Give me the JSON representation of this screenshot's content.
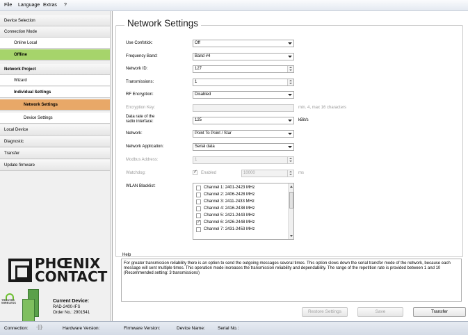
{
  "menu": [
    "File",
    "Language",
    "Extras",
    "?"
  ],
  "sidebar": {
    "items": [
      {
        "label": "Device Selection"
      },
      {
        "label": "Connection Mode"
      },
      {
        "label": "Online Local"
      },
      {
        "label": "Offline"
      },
      {
        "label": "Network Project"
      },
      {
        "label": "Wizard"
      },
      {
        "label": "Individual Settings"
      },
      {
        "label": "Network Settings"
      },
      {
        "label": "Device Settings"
      },
      {
        "label": "Local Device"
      },
      {
        "label": "Diagnostic"
      },
      {
        "label": "Transfer"
      },
      {
        "label": "Update firmware"
      }
    ]
  },
  "logo": {
    "line1": "PHŒNIX",
    "line2": "CONTACT"
  },
  "trusted": {
    "line1": "TRUSTED",
    "line2": "WIRELESS"
  },
  "current_device": {
    "title": "Current Device:",
    "model": "RAD-2400-IFS",
    "order": "Order No.: 2901541"
  },
  "statusbar": {
    "connection": "Connection:",
    "hardware": "Hardware Version:",
    "firmware": "Firmware Version:",
    "device_name": "Device Name:",
    "serial": "Serial No.:"
  },
  "panel": {
    "title": "Network Settings",
    "fields": {
      "use_confstick": {
        "label": "Use Confstick:",
        "value": "Off"
      },
      "frequency_band": {
        "label": "Frequency Band:",
        "value": "Band #4"
      },
      "network_id": {
        "label": "Network ID:",
        "value": "127"
      },
      "transmissions": {
        "label": "Transmissions:",
        "value": "1"
      },
      "rf_encryption": {
        "label": "RF Encryption:",
        "value": "Disabled"
      },
      "encryption_key": {
        "label": "Encryption Key:",
        "value": "",
        "hint": "min. 4, max 16 characters"
      },
      "data_rate": {
        "label1": "Data rate of the",
        "label2": "radio interface:",
        "value": "125",
        "unit": "kBit/s"
      },
      "network": {
        "label": "Network:",
        "value": "Point To Point / Star"
      },
      "network_application": {
        "label": "Network Application:",
        "value": "Serial data"
      },
      "modbus_address": {
        "label": "Modbus Address:",
        "value": "1"
      },
      "watchdog": {
        "label": "Watchdog:",
        "enabled_label": "Enabled",
        "value": "10000",
        "unit": "ms"
      },
      "wlan_blacklist": {
        "label": "WLAN Blacklist:"
      }
    },
    "wlan_channels": [
      {
        "label": "Channel 1: 2401-2423 MHz",
        "checked": false
      },
      {
        "label": "Channel 2: 2406-2428 MHz",
        "checked": false
      },
      {
        "label": "Channel 3: 2411-2433 MHz",
        "checked": false
      },
      {
        "label": "Channel 4: 2416-2438 MHz",
        "checked": false
      },
      {
        "label": "Channel 5: 2421-2443 MHz",
        "checked": false
      },
      {
        "label": "Channel 6: 2426-2448 MHz",
        "checked": true
      },
      {
        "label": "Channel 7: 2431-2453 MHz",
        "checked": false
      }
    ],
    "help": {
      "label": "Help",
      "text": "For greater transmission reliability there is an option to send the outgoing messages several times. This option slows down the serial transfer mode of the network, because each message will sent multiple times. This operation mode increases the transmission reliability and dependability. The range of the repetition rate is provided between 1 and 10 (Recommended setting: 3 transmissions)"
    },
    "buttons": {
      "restore": "Restore Settings",
      "save": "Save",
      "transfer": "Transfer"
    }
  },
  "colors": {
    "offline_green": "#a6d46b",
    "selected_orange": "#e8a868",
    "statusbar": "#d4dbe6"
  }
}
